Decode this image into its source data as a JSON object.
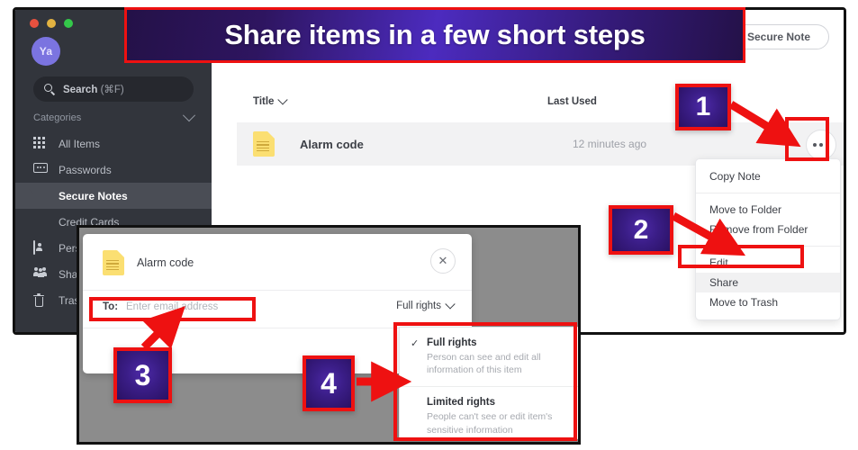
{
  "banner": {
    "text": "Share items in a few short steps",
    "border_color": "#ee1111",
    "gradient_from": "#241148",
    "gradient_to": "#4c2bbf"
  },
  "steps": [
    {
      "number": "1"
    },
    {
      "number": "2"
    },
    {
      "number": "3"
    },
    {
      "number": "4"
    }
  ],
  "sidebar": {
    "avatar_initials": "Ya",
    "search": {
      "label": "Search",
      "shortcut": "(⌘F)"
    },
    "categories_label": "Categories",
    "items": [
      {
        "label": "All Items",
        "icon": "grid-icon",
        "active": false
      },
      {
        "label": "Passwords",
        "icon": "password-icon",
        "active": false
      },
      {
        "label": "Secure Notes",
        "icon": "note-icon",
        "active": true
      },
      {
        "label": "Credit Cards",
        "icon": "credit-card-icon",
        "active": false
      },
      {
        "label": "Perso",
        "icon": "person-icon",
        "active": false
      },
      {
        "label": "Share",
        "icon": "people-icon",
        "active": false
      },
      {
        "label": "Trash",
        "icon": "trash-icon",
        "active": false
      }
    ]
  },
  "topbar": {
    "add_button": "Add Secure Note"
  },
  "list": {
    "columns": {
      "title": "Title",
      "last_used": "Last Used"
    },
    "rows": [
      {
        "title": "Alarm code",
        "last_used": "12 minutes ago",
        "icon": "secure-note-icon"
      }
    ]
  },
  "context_menu": {
    "groups": [
      [
        "Copy Note"
      ],
      [
        "Move to Folder",
        "Remove from Folder"
      ],
      [
        "Edit",
        "Share",
        "Move to Trash"
      ]
    ],
    "highlighted": "Share"
  },
  "share_dialog": {
    "item_title": "Alarm code",
    "close_icon": "✕",
    "to_label": "To:",
    "to_placeholder": "Enter email address",
    "rights_selected": "Full rights",
    "rights_options": [
      {
        "name": "Full rights",
        "description": "Person can see and edit all information of this item",
        "checked": true,
        "check_glyph": "✓"
      },
      {
        "name": "Limited rights",
        "description": "People can't see or edit item's sensitive information",
        "checked": false,
        "check_glyph": ""
      }
    ]
  }
}
